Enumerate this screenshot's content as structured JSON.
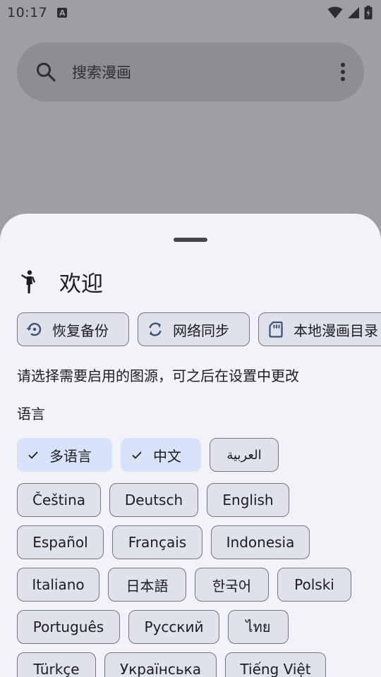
{
  "status_bar": {
    "time": "10:17",
    "a_badge": "A"
  },
  "search": {
    "placeholder": "搜索漫画"
  },
  "sheet": {
    "title": "欢迎",
    "actions": [
      {
        "label": "恢复备份",
        "icon": "restore-icon"
      },
      {
        "label": "网络同步",
        "icon": "sync-icon"
      },
      {
        "label": "本地漫画目录",
        "icon": "sd-card-icon"
      }
    ],
    "description": "请选择需要启用的图源，可之后在设置中更改",
    "language_title": "语言",
    "languages": [
      {
        "label": "多语言",
        "selected": true
      },
      {
        "label": "中文",
        "selected": true
      },
      {
        "label": "العربية",
        "selected": false
      },
      {
        "label": "Čeština",
        "selected": false
      },
      {
        "label": "Deutsch",
        "selected": false
      },
      {
        "label": "English",
        "selected": false
      },
      {
        "label": "Español",
        "selected": false
      },
      {
        "label": "Français",
        "selected": false
      },
      {
        "label": "Indonesia",
        "selected": false
      },
      {
        "label": "Italiano",
        "selected": false
      },
      {
        "label": "日本語",
        "selected": false
      },
      {
        "label": "한국어",
        "selected": false
      },
      {
        "label": "Polski",
        "selected": false
      },
      {
        "label": "Português",
        "selected": false
      },
      {
        "label": "Русский",
        "selected": false
      },
      {
        "label": "ไทย",
        "selected": false
      },
      {
        "label": "Türkçe",
        "selected": false
      },
      {
        "label": "Українська",
        "selected": false
      },
      {
        "label": "Tiếng Việt",
        "selected": false
      }
    ]
  }
}
